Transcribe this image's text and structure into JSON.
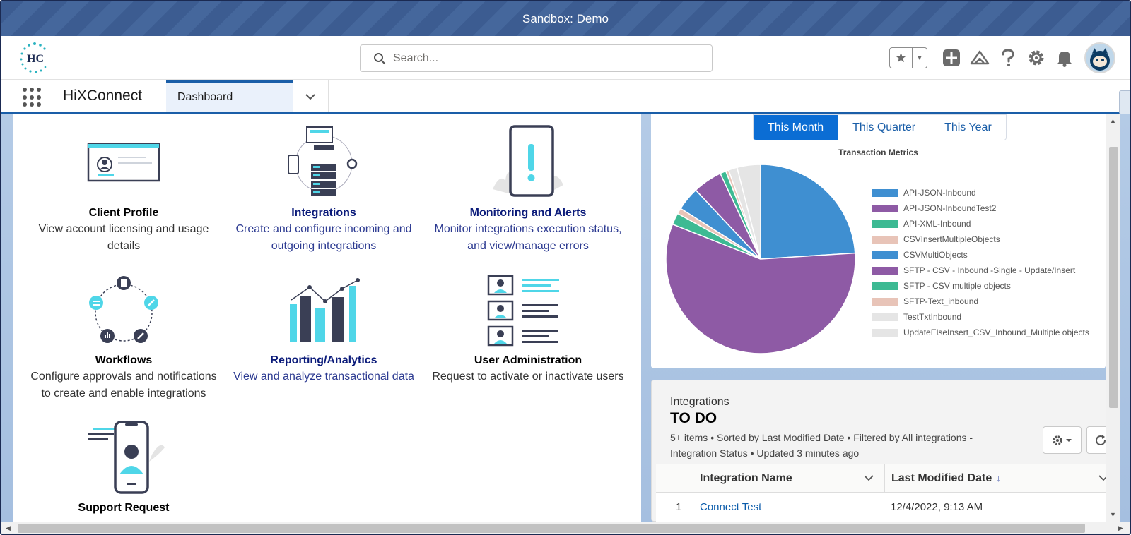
{
  "sandbox_banner": "Sandbox: Demo",
  "header": {
    "logo_text": "HC",
    "search_placeholder": "Search..."
  },
  "nav": {
    "app_name": "HiXConnect",
    "tab_label": "Dashboard"
  },
  "tiles": [
    {
      "title": "Client Profile",
      "desc_line1": "View account licensing and usage",
      "desc_line2": "details",
      "icon": "client-profile-illustration"
    },
    {
      "title": "Integrations",
      "desc_line1": "Create and configure incoming and",
      "desc_line2": "outgoing integrations",
      "icon": "integrations-illustration"
    },
    {
      "title": "Monitoring and Alerts",
      "desc_line1": "Monitor integrations execution status,",
      "desc_line2": "and view/manage errors",
      "icon": "monitoring-illustration"
    },
    {
      "title": "Workflows",
      "desc_line1": "Configure approvals and notifications",
      "desc_line2": "to create and enable integrations",
      "icon": "workflows-illustration"
    },
    {
      "title": "Reporting/Analytics",
      "desc_line1": "View and analyze transactional data",
      "desc_line2": "",
      "icon": "reporting-illustration"
    },
    {
      "title": "User Administration",
      "desc_line1": "Request to activate or inactivate users",
      "desc_line2": "",
      "icon": "user-admin-illustration"
    },
    {
      "title": "Support Request",
      "desc_line1": "",
      "desc_line2": "",
      "icon": "support-request-illustration"
    }
  ],
  "period_tabs": [
    "This Month",
    "This Quarter",
    "This Year"
  ],
  "period_active": "This Month",
  "chart_data": {
    "type": "pie",
    "title": "Transaction Metrics",
    "labels": [
      "API-JSON-Inbound",
      "API-JSON-InboundTest2",
      "API-XML-Inbound",
      "CSVInsertMultipleObjects",
      "CSVMultiObjects",
      "SFTP - CSV - Inbound -Single - Update/Insert",
      "SFTP - CSV multiple objects",
      "SFTP-Text_inbound",
      "TestTxtInbound",
      "UpdateElseInsert_CSV_Inbound_Multiple objects"
    ],
    "values": [
      24,
      57,
      2,
      1,
      4,
      5,
      1,
      0.5,
      1.5,
      4
    ],
    "colors": [
      "#3f8fd1",
      "#8e5aa5",
      "#3dba93",
      "#e8c4b8",
      "#3f8fd1",
      "#8e5aa5",
      "#3dba93",
      "#e8c4b8",
      "#e5e5e5",
      "#e5e5e5"
    ],
    "legend_position": "right"
  },
  "list_view": {
    "object_label": "Integrations",
    "title": "TO DO",
    "meta_line1": "5+ items • Sorted by Last Modified Date • Filtered by All integrations -",
    "meta_line2": "Integration Status • Updated 3 minutes ago",
    "columns": [
      "Integration Name",
      "Last Modified Date"
    ],
    "rows": [
      {
        "num": "1",
        "name": "Connect Test",
        "modified": "12/4/2022, 9:13 AM"
      }
    ]
  }
}
